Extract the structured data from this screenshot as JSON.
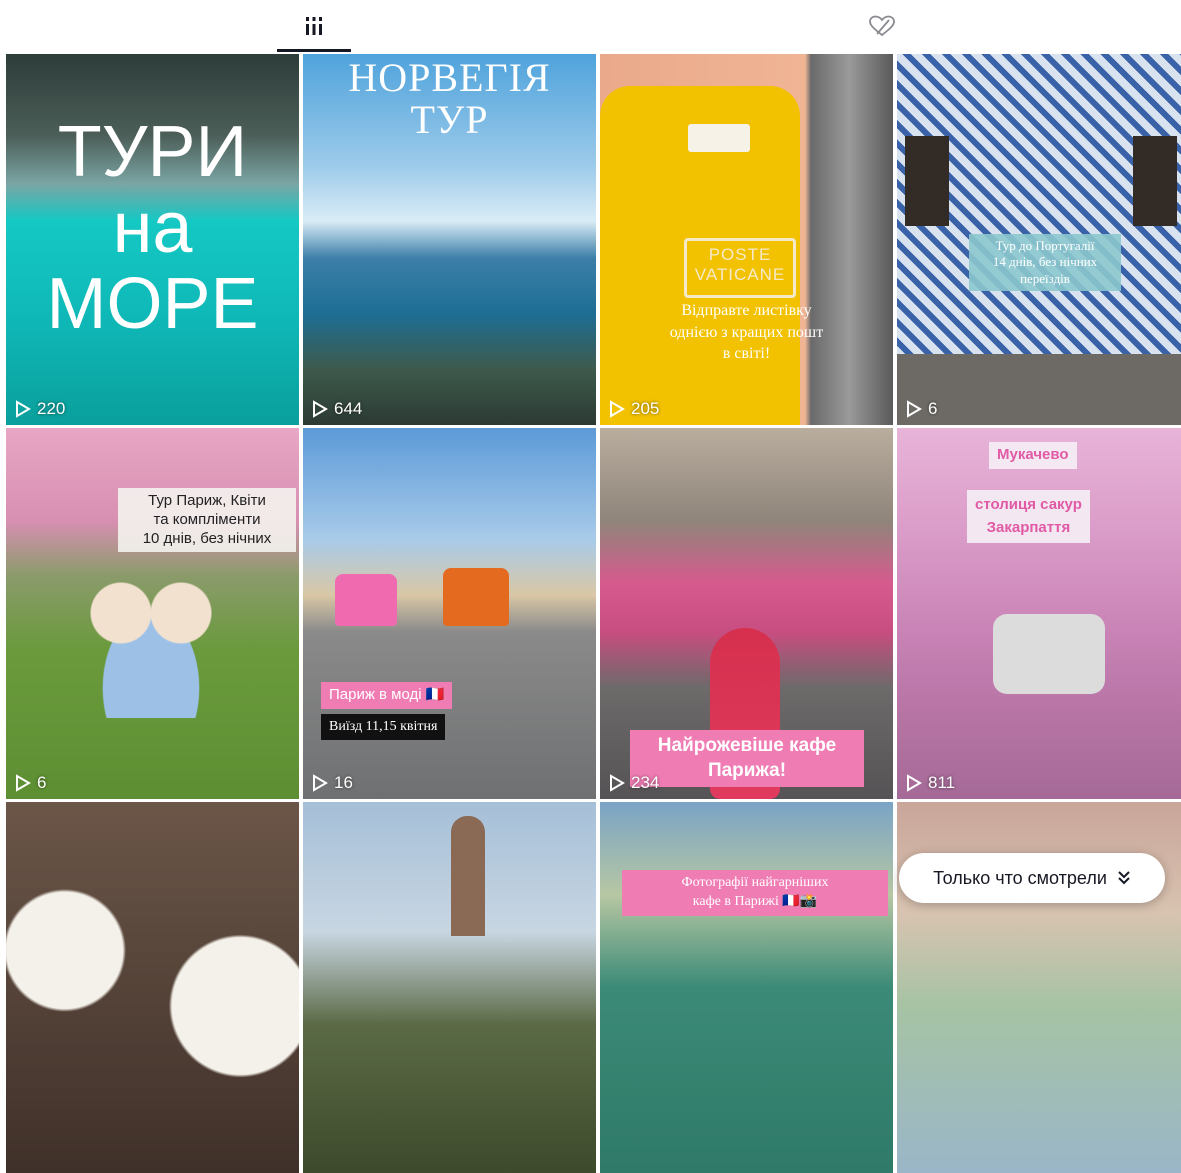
{
  "tabs": {
    "videos": {
      "icon": "grid-bars-icon"
    },
    "liked": {
      "icon": "heart-slash-icon"
    }
  },
  "videos": [
    {
      "views": "220",
      "lines": [
        "ТУРИ",
        "на",
        "МОРЕ"
      ]
    },
    {
      "views": "644",
      "lines": [
        "НОРВЕГІЯ",
        "ТУР"
      ]
    },
    {
      "views": "205",
      "sign_lines": [
        "POSTE",
        "VATICANE"
      ],
      "lines": [
        "Відправте листівку",
        "однією з кращих пошт",
        "в світі!"
      ]
    },
    {
      "views": "6",
      "lines": [
        "Тур до Португалії",
        "14 днів, без нічних",
        "переїздів"
      ]
    },
    {
      "views": "6",
      "lines": [
        "Тур Париж, Квіти",
        "та компліменти",
        "10 днів, без нічних"
      ]
    },
    {
      "views": "16",
      "lines": [
        "Париж в моді 🇫🇷",
        "Виїзд 11,15 квітня"
      ]
    },
    {
      "views": "234",
      "lines": [
        "Найрожевіше кафе",
        "Парижа!"
      ]
    },
    {
      "views": "811",
      "lines": [
        "Мукачево",
        "столиця сакур",
        "Закарпаття"
      ]
    },
    {
      "views": ""
    },
    {
      "views": ""
    },
    {
      "views": "",
      "lines": [
        "Фотографії найгарніших",
        "кафе в Парижі 🇫🇷📸"
      ]
    },
    {
      "views": ""
    }
  ],
  "recent": {
    "label": "Только что смотрели",
    "icon": "double-chevron-down-icon"
  }
}
